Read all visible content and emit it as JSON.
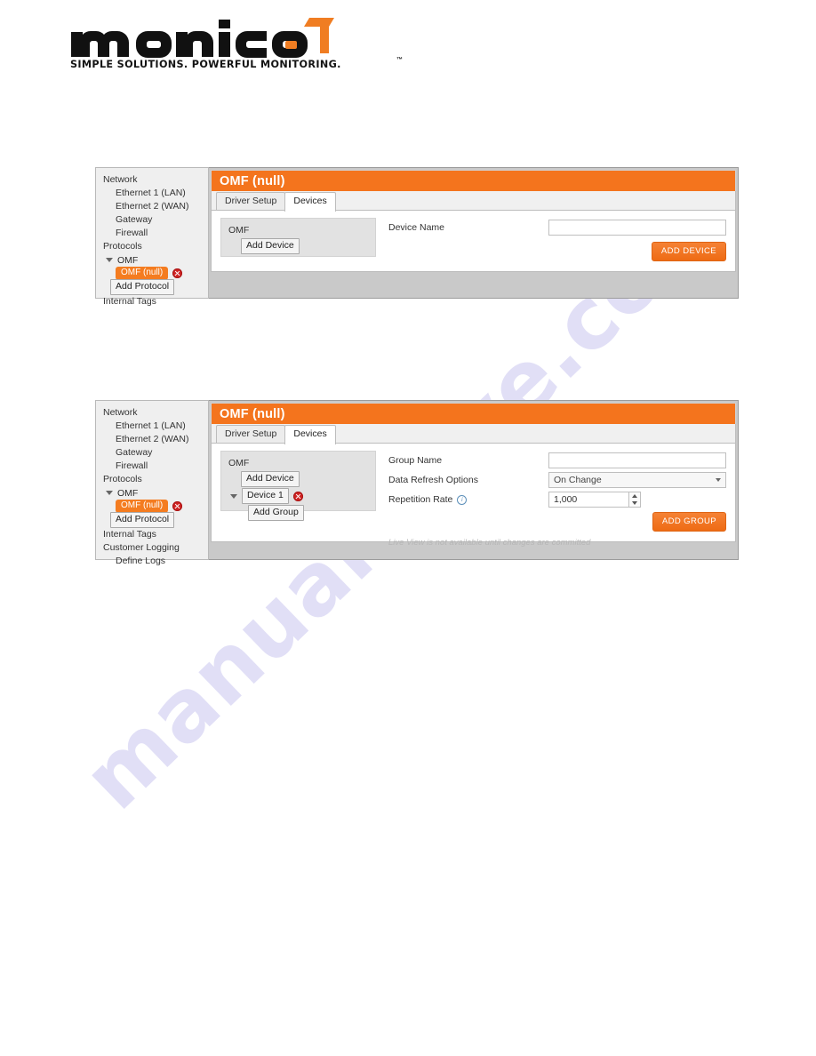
{
  "logo": {
    "wordmark": "monico",
    "tagline": "SIMPLE SOLUTIONS. POWERFUL MONITORING.",
    "trademark": "™",
    "brand_orange": "#f07d22",
    "brand_black": "#111111"
  },
  "watermark": {
    "text": "manualshive.com",
    "color": "#c9c6ef"
  },
  "panel_one": {
    "title": "OMF (null)",
    "tabs": [
      {
        "label": "Driver Setup",
        "active": false
      },
      {
        "label": "Devices",
        "active": true
      }
    ],
    "sidebar": {
      "items": [
        {
          "label": "Network",
          "indent": 0,
          "type": "text"
        },
        {
          "label": "Ethernet 1 (LAN)",
          "indent": 1,
          "type": "text"
        },
        {
          "label": "Ethernet 2 (WAN)",
          "indent": 1,
          "type": "text"
        },
        {
          "label": "Gateway",
          "indent": 1,
          "type": "text"
        },
        {
          "label": "Firewall",
          "indent": 1,
          "type": "text"
        },
        {
          "label": "Protocols",
          "indent": 0,
          "type": "text"
        },
        {
          "label": "OMF",
          "indent": 1,
          "type": "tree"
        },
        {
          "label": "OMF (null)",
          "indent": 2,
          "type": "chip"
        },
        {
          "label": "Add Protocol",
          "indent": 1,
          "type": "button"
        },
        {
          "label": "Internal Tags",
          "indent": 0,
          "type": "text"
        }
      ]
    },
    "tree": {
      "root_label": "OMF",
      "add_device_label": "Add Device"
    },
    "form": {
      "device_name_label": "Device Name",
      "device_name_value": "",
      "device_name_placeholder": "",
      "add_device_button": "ADD DEVICE"
    }
  },
  "panel_two": {
    "title": "OMF (null)",
    "tabs": [
      {
        "label": "Driver Setup",
        "active": false
      },
      {
        "label": "Devices",
        "active": true
      }
    ],
    "sidebar": {
      "items": [
        {
          "label": "Network",
          "indent": 0,
          "type": "text"
        },
        {
          "label": "Ethernet 1 (LAN)",
          "indent": 1,
          "type": "text"
        },
        {
          "label": "Ethernet 2 (WAN)",
          "indent": 1,
          "type": "text"
        },
        {
          "label": "Gateway",
          "indent": 1,
          "type": "text"
        },
        {
          "label": "Firewall",
          "indent": 1,
          "type": "text"
        },
        {
          "label": "Protocols",
          "indent": 0,
          "type": "text"
        },
        {
          "label": "OMF",
          "indent": 1,
          "type": "tree"
        },
        {
          "label": "OMF (null)",
          "indent": 2,
          "type": "chip"
        },
        {
          "label": "Add Protocol",
          "indent": 1,
          "type": "button"
        },
        {
          "label": "Internal Tags",
          "indent": 0,
          "type": "text"
        },
        {
          "label": "Customer Logging",
          "indent": 0,
          "type": "text"
        },
        {
          "label": "Define Logs",
          "indent": 1,
          "type": "text"
        }
      ]
    },
    "tree": {
      "root_label": "OMF",
      "add_device_label": "Add Device",
      "device_label": "Device 1",
      "add_group_label": "Add Group"
    },
    "form": {
      "group_name_label": "Group Name",
      "group_name_value": "",
      "group_name_placeholder": "",
      "data_refresh_label": "Data Refresh Options",
      "data_refresh_value": "On Change",
      "repetition_rate_label": "Repetition Rate",
      "repetition_rate_value": "1,000",
      "add_group_button": "ADD GROUP",
      "note": "Live View is not available until changes are committed"
    }
  }
}
